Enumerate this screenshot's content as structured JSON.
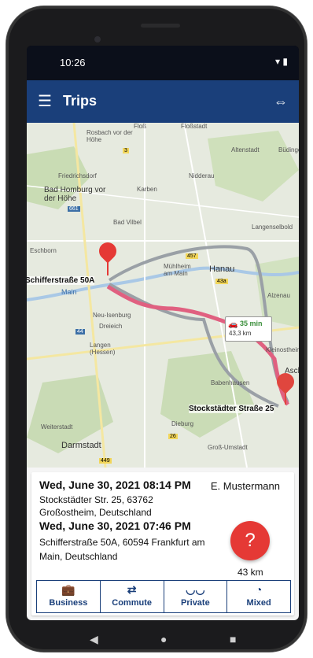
{
  "status": {
    "time": "10:26",
    "icons": "▾ ▮"
  },
  "appbar": {
    "title": "Trips",
    "menu_icon": "☰",
    "link_icon": "⇔"
  },
  "map": {
    "places": [
      {
        "name": "Floß"
      },
      {
        "name": "Floßstadt"
      },
      {
        "name": "Rosbach vor der Höhe"
      },
      {
        "name": "Friedrichsdorf"
      },
      {
        "name": "Altenstadt"
      },
      {
        "name": "Büdingen"
      },
      {
        "name": "Bad Homburg vor der Höhe"
      },
      {
        "name": "Karben"
      },
      {
        "name": "Nidderau"
      },
      {
        "name": "Bad Vilbel"
      },
      {
        "name": "Langenselbold"
      },
      {
        "name": "Eschborn"
      },
      {
        "name": "Hanau"
      },
      {
        "name": "Mühlheim am Main"
      },
      {
        "name": "Alzenau"
      },
      {
        "name": "Neu-Isenburg"
      },
      {
        "name": "Dreieich"
      },
      {
        "name": "Langen (Hessen)"
      },
      {
        "name": "Kleinostheim"
      },
      {
        "name": "Babenhausen"
      },
      {
        "name": "Weiterstadt"
      },
      {
        "name": "Darmstadt"
      },
      {
        "name": "Dieburg"
      },
      {
        "name": "Groß-Umstadt"
      },
      {
        "name": "Main"
      },
      {
        "name": "Asch"
      }
    ],
    "road_numbers": [
      "3",
      "3",
      "45",
      "661",
      "457",
      "3",
      "49",
      "43a",
      "44",
      "45",
      "661",
      "7",
      "45",
      "26",
      "26",
      "449",
      "3",
      "26",
      "3",
      "45"
    ],
    "origin_label": "Schifferstraße 50A",
    "destination_label": "Stockstädter Straße 25",
    "eta": {
      "time": "35 min",
      "distance": "43,3 km"
    }
  },
  "trip": {
    "end_datetime": "Wed, June 30, 2021 08:14 PM",
    "end_address_line1": "Stockstädter Str. 25, 63762",
    "end_address_line2": "Großostheim, Deutschland",
    "start_datetime": "Wed, June 30, 2021 07:46 PM",
    "start_address_line1": "Schifferstraße 50A, 60594 Frankfurt am",
    "start_address_line2": "Main, Deutschland",
    "driver": "E. Mustermann",
    "fab_label": "?",
    "distance": "43 km"
  },
  "categories": [
    {
      "label": "Business",
      "icon": "💼"
    },
    {
      "label": "Commute",
      "icon": "⇄"
    },
    {
      "label": "Private",
      "icon": "◡◡"
    },
    {
      "label": "Mixed",
      "icon": "◔"
    }
  ],
  "colors": {
    "primary": "#1a3f7a",
    "route": "#e06080",
    "fab": "#e53935",
    "eta": "#3b8f3b"
  }
}
